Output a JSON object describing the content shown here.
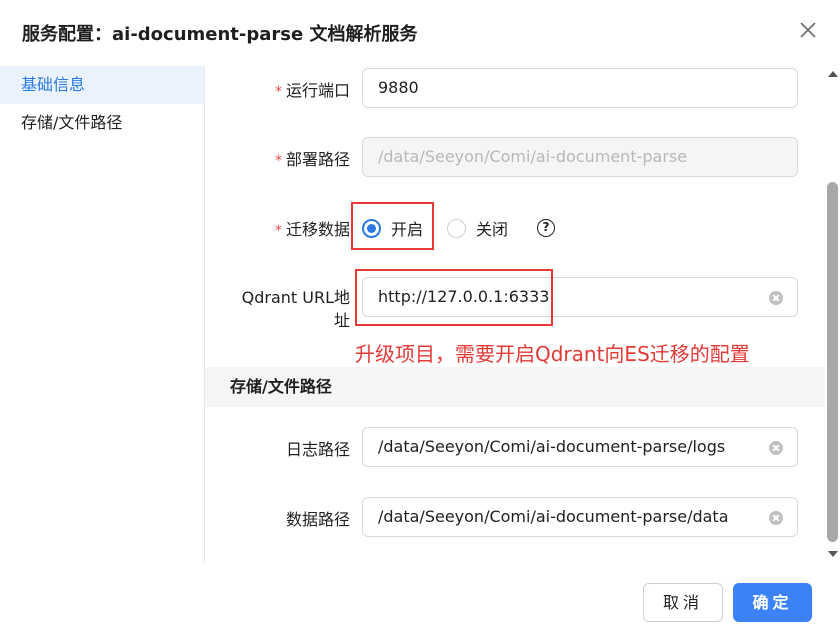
{
  "dialog": {
    "title": "服务配置：ai-document-parse 文档解析服务"
  },
  "sidebar": {
    "items": [
      {
        "label": "基础信息"
      },
      {
        "label": "存储/文件路径"
      }
    ]
  },
  "form": {
    "port": {
      "label": "运行端口",
      "value": "9880"
    },
    "deploy_path": {
      "label": "部署路径",
      "value": "/data/Seeyon/Comi/ai-document-parse"
    },
    "migrate": {
      "label": "迁移数据",
      "option_on": "开启",
      "option_off": "关闭",
      "selected": "开启",
      "help": "?"
    },
    "qdrant": {
      "label_line1": "Qdrant URL地",
      "label_line2": "址",
      "value": "http://127.0.0.1:6333"
    },
    "annotation": "升级项目，需要开启Qdrant向ES迁移的配置",
    "storage_section": "存储/文件路径",
    "log_path": {
      "label": "日志路径",
      "value": "/data/Seeyon/Comi/ai-document-parse/logs"
    },
    "data_path": {
      "label": "数据路径",
      "value": "/data/Seeyon/Comi/ai-document-parse/data"
    }
  },
  "footer": {
    "cancel": "取消",
    "ok": "确定"
  },
  "colors": {
    "accent": "#2a7ae2",
    "primary_button": "#3b82f6",
    "annotation_red": "#e53935"
  }
}
